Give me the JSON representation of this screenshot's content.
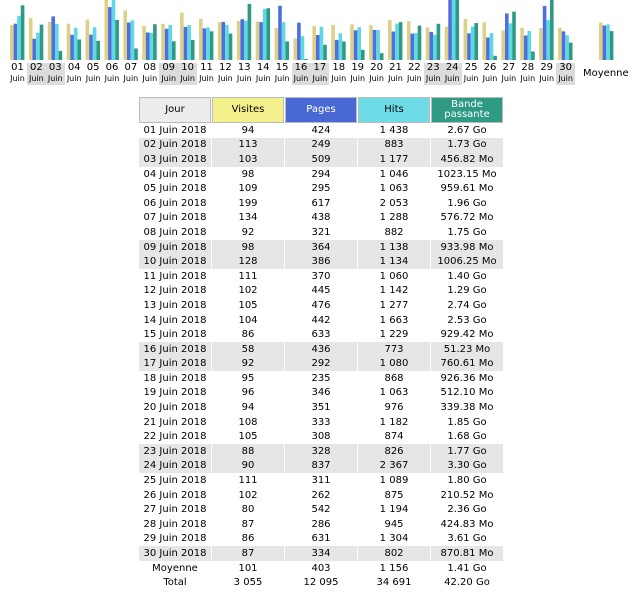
{
  "colors": {
    "visits": "#ddd187",
    "pages": "#4f6fdd",
    "hits": "#5fd8e6",
    "bandwidth": "#2e9a84",
    "weekend": "#dcdcdc"
  },
  "chart_data": {
    "type": "bar",
    "categories": [
      "01",
      "02",
      "03",
      "04",
      "05",
      "06",
      "07",
      "08",
      "09",
      "10",
      "11",
      "12",
      "13",
      "14",
      "15",
      "16",
      "17",
      "18",
      "19",
      "20",
      "21",
      "22",
      "23",
      "24",
      "25",
      "26",
      "27",
      "28",
      "29",
      "30"
    ],
    "month_label": "Juin",
    "average_label": "Moyenne",
    "series": [
      {
        "key": "visits",
        "values": [
          94,
          113,
          103,
          98,
          109,
          199,
          134,
          92,
          98,
          128,
          111,
          102,
          105,
          104,
          86,
          58,
          92,
          95,
          96,
          94,
          108,
          105,
          88,
          90,
          111,
          102,
          80,
          87,
          86,
          87
        ],
        "average": 101
      },
      {
        "key": "pages",
        "values": [
          424,
          249,
          509,
          294,
          295,
          617,
          438,
          321,
          364,
          386,
          370,
          445,
          476,
          442,
          633,
          436,
          292,
          235,
          346,
          351,
          333,
          308,
          328,
          837,
          311,
          262,
          542,
          286,
          631,
          334
        ],
        "average": 403
      },
      {
        "key": "hits",
        "values": [
          1438,
          883,
          1177,
          1046,
          1063,
          2053,
          1288,
          882,
          1138,
          1134,
          1060,
          1142,
          1277,
          1663,
          1229,
          773,
          1080,
          868,
          1063,
          976,
          1182,
          874,
          826,
          2367,
          1089,
          875,
          1194,
          945,
          1304,
          802
        ],
        "average": 1156
      },
      {
        "key": "bandwidth_mo",
        "values": [
          2734,
          1772,
          456.82,
          1023.15,
          959.61,
          2007,
          576.72,
          1792,
          933.98,
          1006.25,
          1434,
          1321,
          2806,
          2591,
          929.42,
          51.23,
          760.61,
          926.36,
          512.1,
          339.38,
          1894,
          1720,
          1812,
          3379,
          1843,
          210.52,
          2417,
          424.83,
          3697,
          870.81
        ],
        "average": 1444
      }
    ],
    "weekend_days": [
      "02",
      "03",
      "09",
      "10",
      "16",
      "17",
      "23",
      "24",
      "30"
    ]
  },
  "table": {
    "headers": {
      "day": "Jour",
      "visits": "Visites",
      "pages": "Pages",
      "hits": "Hits",
      "bandwidth": "Bande passante"
    },
    "rows": [
      {
        "day": "01 Juin 2018",
        "visits": "94",
        "pages": "424",
        "hits": "1 438",
        "bw": "2.67 Go"
      },
      {
        "day": "02 Juin 2018",
        "visits": "113",
        "pages": "249",
        "hits": "883",
        "bw": "1.73 Go"
      },
      {
        "day": "03 Juin 2018",
        "visits": "103",
        "pages": "509",
        "hits": "1 177",
        "bw": "456.82 Mo"
      },
      {
        "day": "04 Juin 2018",
        "visits": "98",
        "pages": "294",
        "hits": "1 046",
        "bw": "1023.15 Mo"
      },
      {
        "day": "05 Juin 2018",
        "visits": "109",
        "pages": "295",
        "hits": "1 063",
        "bw": "959.61 Mo"
      },
      {
        "day": "06 Juin 2018",
        "visits": "199",
        "pages": "617",
        "hits": "2 053",
        "bw": "1.96 Go"
      },
      {
        "day": "07 Juin 2018",
        "visits": "134",
        "pages": "438",
        "hits": "1 288",
        "bw": "576.72 Mo"
      },
      {
        "day": "08 Juin 2018",
        "visits": "92",
        "pages": "321",
        "hits": "882",
        "bw": "1.75 Go"
      },
      {
        "day": "09 Juin 2018",
        "visits": "98",
        "pages": "364",
        "hits": "1 138",
        "bw": "933.98 Mo"
      },
      {
        "day": "10 Juin 2018",
        "visits": "128",
        "pages": "386",
        "hits": "1 134",
        "bw": "1006.25 Mo"
      },
      {
        "day": "11 Juin 2018",
        "visits": "111",
        "pages": "370",
        "hits": "1 060",
        "bw": "1.40 Go"
      },
      {
        "day": "12 Juin 2018",
        "visits": "102",
        "pages": "445",
        "hits": "1 142",
        "bw": "1.29 Go"
      },
      {
        "day": "13 Juin 2018",
        "visits": "105",
        "pages": "476",
        "hits": "1 277",
        "bw": "2.74 Go"
      },
      {
        "day": "14 Juin 2018",
        "visits": "104",
        "pages": "442",
        "hits": "1 663",
        "bw": "2.53 Go"
      },
      {
        "day": "15 Juin 2018",
        "visits": "86",
        "pages": "633",
        "hits": "1 229",
        "bw": "929.42 Mo"
      },
      {
        "day": "16 Juin 2018",
        "visits": "58",
        "pages": "436",
        "hits": "773",
        "bw": "51.23 Mo"
      },
      {
        "day": "17 Juin 2018",
        "visits": "92",
        "pages": "292",
        "hits": "1 080",
        "bw": "760.61 Mo"
      },
      {
        "day": "18 Juin 2018",
        "visits": "95",
        "pages": "235",
        "hits": "868",
        "bw": "926.36 Mo"
      },
      {
        "day": "19 Juin 2018",
        "visits": "96",
        "pages": "346",
        "hits": "1 063",
        "bw": "512.10 Mo"
      },
      {
        "day": "20 Juin 2018",
        "visits": "94",
        "pages": "351",
        "hits": "976",
        "bw": "339.38 Mo"
      },
      {
        "day": "21 Juin 2018",
        "visits": "108",
        "pages": "333",
        "hits": "1 182",
        "bw": "1.85 Go"
      },
      {
        "day": "22 Juin 2018",
        "visits": "105",
        "pages": "308",
        "hits": "874",
        "bw": "1.68 Go"
      },
      {
        "day": "23 Juin 2018",
        "visits": "88",
        "pages": "328",
        "hits": "826",
        "bw": "1.77 Go"
      },
      {
        "day": "24 Juin 2018",
        "visits": "90",
        "pages": "837",
        "hits": "2 367",
        "bw": "3.30 Go"
      },
      {
        "day": "25 Juin 2018",
        "visits": "111",
        "pages": "311",
        "hits": "1 089",
        "bw": "1.80 Go"
      },
      {
        "day": "26 Juin 2018",
        "visits": "102",
        "pages": "262",
        "hits": "875",
        "bw": "210.52 Mo"
      },
      {
        "day": "27 Juin 2018",
        "visits": "80",
        "pages": "542",
        "hits": "1 194",
        "bw": "2.36 Go"
      },
      {
        "day": "28 Juin 2018",
        "visits": "87",
        "pages": "286",
        "hits": "945",
        "bw": "424.83 Mo"
      },
      {
        "day": "29 Juin 2018",
        "visits": "86",
        "pages": "631",
        "hits": "1 304",
        "bw": "3.61 Go"
      },
      {
        "day": "30 Juin 2018",
        "visits": "87",
        "pages": "334",
        "hits": "802",
        "bw": "870.81 Mo"
      }
    ],
    "average": {
      "day": "Moyenne",
      "visits": "101",
      "pages": "403",
      "hits": "1 156",
      "bw": "1.41 Go"
    },
    "total": {
      "day": "Total",
      "visits": "3 055",
      "pages": "12 095",
      "hits": "34 691",
      "bw": "42.20 Go"
    }
  }
}
